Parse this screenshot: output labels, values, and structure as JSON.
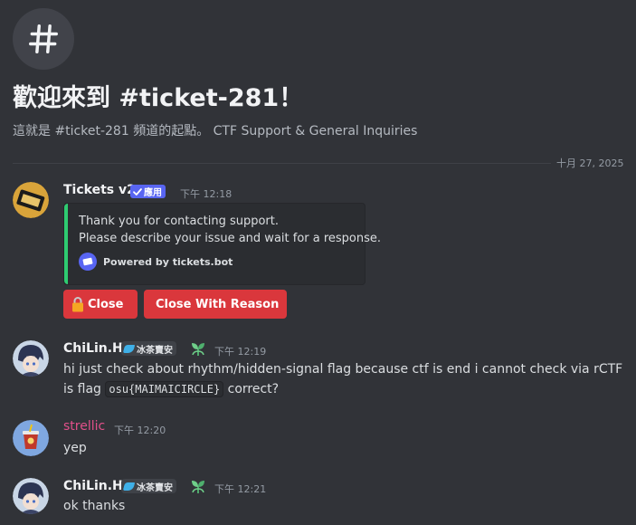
{
  "channel": {
    "welcome_title": "歡迎來到 #ticket-281！",
    "welcome_subtitle": "這就是 #ticket-281 頻道的起點。 CTF Support & General Inquiries",
    "date_divider": "十月 27, 2025",
    "icon": "hash-icon"
  },
  "messages": [
    {
      "author": "Tickets v2",
      "author_color": "#f2f3f5",
      "badge_label": "應用",
      "timestamp": "下午 12:18",
      "embed": {
        "accent_color": "#2ecc71",
        "description_lines": [
          "Thank you for contacting support.",
          "Please describe your issue and wait for a response."
        ],
        "footer_text": "Powered by tickets.bot"
      },
      "buttons": [
        {
          "label": "Close",
          "icon": "lock-icon",
          "color": "#da373c"
        },
        {
          "label": "Close With Reason",
          "icon": "lock-icon",
          "color": "#da373c"
        }
      ]
    },
    {
      "author": "ChiLin.H",
      "author_color": "#f2f3f5",
      "tag_label": "冰茶賣安",
      "timestamp": "下午 12:19",
      "text_before": "hi just check about rhythm/hidden-signal flag because ctf is end i cannot check via rCTF is flag ",
      "code": "osu{MAIMAICIRCLE}",
      "text_after": " correct?"
    },
    {
      "author": "strellic",
      "author_color": "#e2508a",
      "timestamp": "下午 12:20",
      "text": "yep"
    },
    {
      "author": "ChiLin.H",
      "author_color": "#f2f3f5",
      "tag_label": "冰茶賣安",
      "timestamp": "下午 12:21",
      "text": "ok thanks"
    }
  ]
}
